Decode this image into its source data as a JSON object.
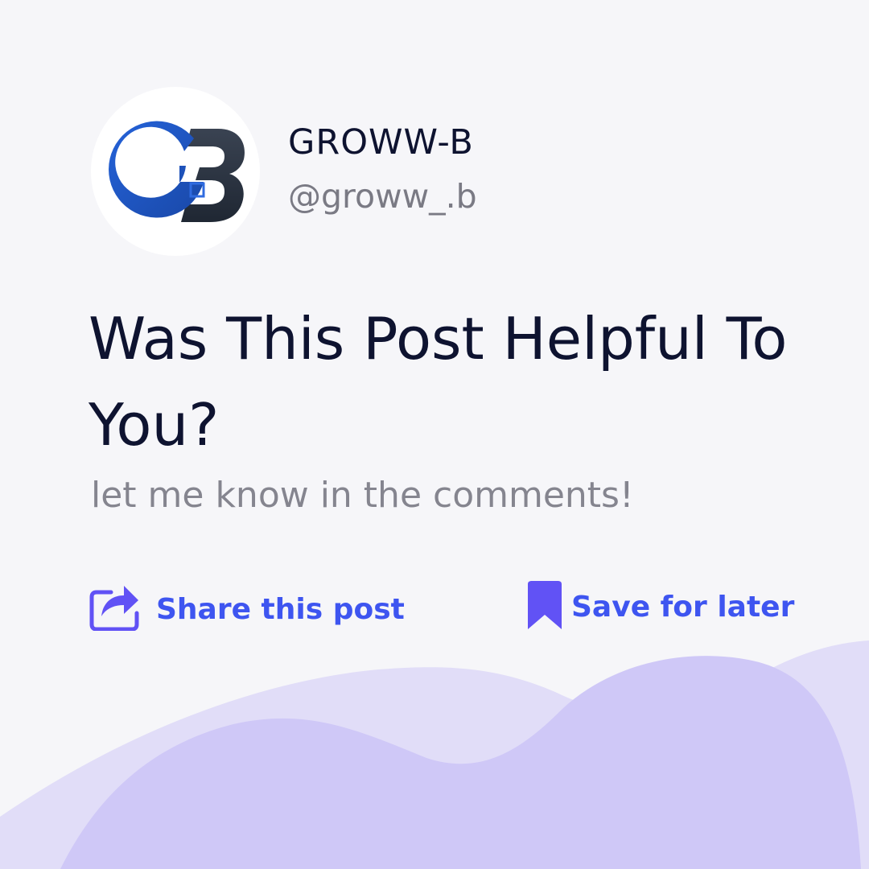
{
  "profile": {
    "name": "GROWW-B",
    "handle": "@groww_.b",
    "avatar_icon": "gb-logo-icon"
  },
  "post": {
    "headline": "Was This Post Helpful To You?",
    "subtext": "let me know in the comments!"
  },
  "actions": {
    "share_label": "Share this post",
    "share_icon": "share-icon",
    "save_label": "Save for later",
    "save_icon": "bookmark-icon"
  },
  "colors": {
    "background": "#f6f6f9",
    "text_primary": "#0e1330",
    "text_secondary": "#85858f",
    "accent": "#3e55f0",
    "icon_purple": "#6152f5",
    "blob_light": "#e1ddf8",
    "blob_dark": "#cfc8f7"
  }
}
